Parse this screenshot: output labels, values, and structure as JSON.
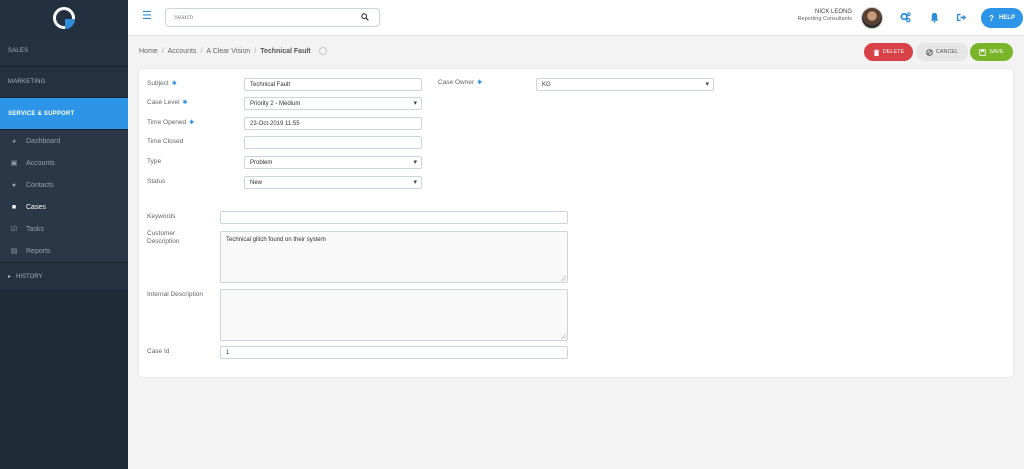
{
  "sidebar": {
    "sections": {
      "sales": "SALES",
      "marketing": "MARKETING",
      "service": "SERVICE & SUPPORT"
    },
    "items": [
      {
        "label": "Dashboard",
        "icon": "dashboard-icon"
      },
      {
        "label": "Accounts",
        "icon": "building-icon"
      },
      {
        "label": "Contacts",
        "icon": "users-icon"
      },
      {
        "label": "Cases",
        "icon": "briefcase-icon"
      },
      {
        "label": "Tasks",
        "icon": "check-square-icon"
      },
      {
        "label": "Reports",
        "icon": "report-icon"
      }
    ],
    "active_item": "Cases",
    "history": "HISTORY"
  },
  "topbar": {
    "search_placeholder": "Search",
    "user_name": "NICK LEONG",
    "user_role": "Reporting Consultants",
    "help_label": "HELP",
    "icons": [
      "menu-icon",
      "search-icon",
      "settings-cogs-icon",
      "bell-icon",
      "logout-icon",
      "question-icon"
    ]
  },
  "breadcrumb": {
    "items": [
      "Home",
      "Accounts",
      "A Clear Vision"
    ],
    "current": "Technical Fault"
  },
  "actions": {
    "delete": "DELETE",
    "cancel": "CANCEL",
    "save": "SAVE"
  },
  "form": {
    "subject": {
      "label": "Subject",
      "value": "Technical Fault"
    },
    "case_owner": {
      "label": "Case Owner",
      "value": "KG"
    },
    "case_level": {
      "label": "Case Level",
      "value": "Priority 2 - Medium"
    },
    "time_opened": {
      "label": "Time Opened",
      "value": "23-Oct-2019 11:55"
    },
    "time_closed": {
      "label": "Time Closed",
      "value": ""
    },
    "type": {
      "label": "Type",
      "value": "Problem"
    },
    "status": {
      "label": "Status",
      "value": "New"
    },
    "keywords": {
      "label": "Keywords",
      "value": ""
    },
    "customer_description": {
      "label": "Customer Description",
      "value": "Technical glitch found on their system"
    },
    "internal_description": {
      "label": "Internal Description",
      "value": ""
    },
    "case_id": {
      "label": "Case Id",
      "value": "1"
    }
  },
  "colors": {
    "sidebar_bg": "#1f2a37",
    "accent": "#2d95e8",
    "delete": "#d94148",
    "save": "#79b52b"
  }
}
